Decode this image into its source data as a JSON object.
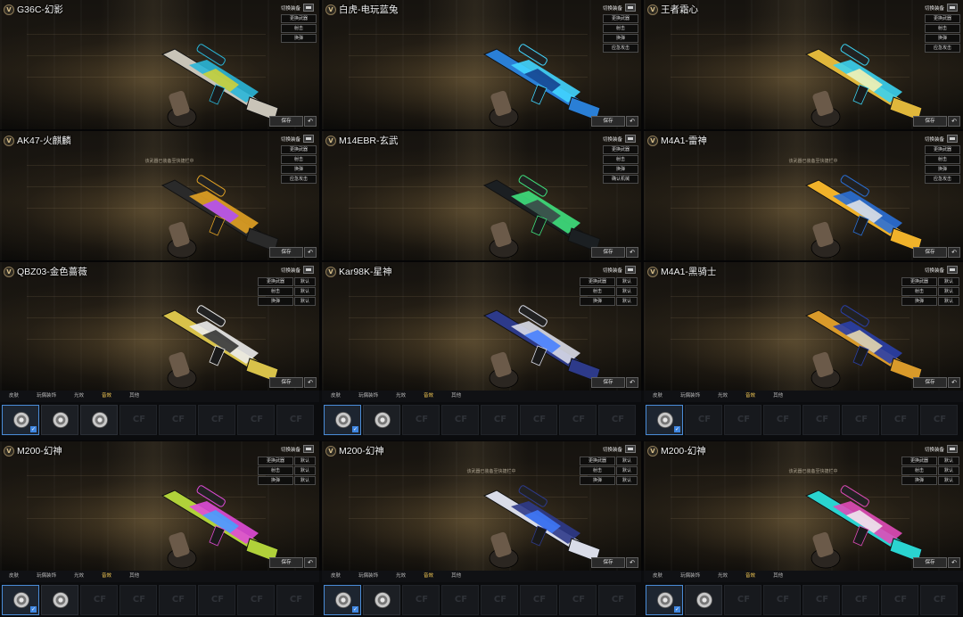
{
  "panels": [
    {
      "name": "G36C-幻影",
      "menu": [
        "更换武器",
        "射击",
        "换弹"
      ],
      "menu_style": "single",
      "hint": "",
      "colors": [
        "#c9c4b8",
        "#2ab6d8",
        "#d7d230"
      ]
    },
    {
      "name": "白虎-电玩蓝兔",
      "menu": [
        "更换武器",
        "射击",
        "换弹",
        "应急攻击"
      ],
      "menu_style": "single",
      "hint": "",
      "colors": [
        "#2a7fd6",
        "#41d5ff",
        "#133a8a"
      ]
    },
    {
      "name": "王者霜心",
      "menu": [
        "更换武器",
        "射击",
        "换弹",
        "应急攻击"
      ],
      "menu_style": "single",
      "hint": "",
      "colors": [
        "#e0b73b",
        "#3bd2f0",
        "#fff3b0"
      ]
    },
    {
      "name": "AK47-火麒麟",
      "menu": [
        "更换武器",
        "射击",
        "换弹",
        "应急攻击"
      ],
      "menu_style": "single",
      "hint": "该武器已装备至快捷栏中",
      "colors": [
        "#2a2a2a",
        "#e2a224",
        "#b24bff"
      ]
    },
    {
      "name": "M14EBR-玄武",
      "menu": [
        "更换武器",
        "射击",
        "换弹",
        "确认机械"
      ],
      "menu_style": "single",
      "hint": "",
      "colors": [
        "#1b1f22",
        "#3fe07d",
        "#3b3f45"
      ]
    },
    {
      "name": "M4A1-雷神",
      "menu": [
        "更换武器",
        "射击",
        "换弹",
        "应急攻击"
      ],
      "menu_style": "single",
      "hint": "该武器已装备至快捷栏中",
      "colors": [
        "#f0b22a",
        "#2a6fd6",
        "#e8e8e8"
      ]
    },
    {
      "name": "QBZ03-金色蔷薇",
      "menu": [
        [
          "更换武器",
          "默认"
        ],
        [
          "射击",
          "默认"
        ],
        [
          "换弹",
          "默认"
        ]
      ],
      "menu_style": "double",
      "hint": "",
      "colors": [
        "#d8c24a",
        "#ececec",
        "#2c2c2c"
      ]
    },
    {
      "name": "Kar98K-星神",
      "menu": [
        [
          "更换武器",
          "默认"
        ],
        [
          "射击",
          "默认"
        ],
        [
          "换弹",
          "默认"
        ]
      ],
      "menu_style": "double",
      "hint": "",
      "colors": [
        "#2d3a8a",
        "#d9dce8",
        "#3f7bff"
      ]
    },
    {
      "name": "M4A1-黑骑士",
      "menu": [
        [
          "更换武器",
          "默认"
        ],
        [
          "射击",
          "默认"
        ],
        [
          "换弹",
          "默认"
        ]
      ],
      "menu_style": "double",
      "hint": "",
      "colors": [
        "#d99a2a",
        "#2a3fa8",
        "#f0e0b0"
      ]
    },
    {
      "name": "M200-幻神",
      "menu": [
        [
          "更换武器",
          "默认"
        ],
        [
          "射击",
          "默认"
        ],
        [
          "换弹",
          "默认"
        ]
      ],
      "menu_style": "double",
      "hint": "",
      "colors": [
        "#b0d13a",
        "#e04bd8",
        "#3fa6ff"
      ]
    },
    {
      "name": "M200-幻神",
      "menu": [
        [
          "更换武器",
          "默认"
        ],
        [
          "射击",
          "默认"
        ],
        [
          "换弹",
          "默认"
        ]
      ],
      "menu_style": "double",
      "hint": "该武器已装备至快捷栏中",
      "colors": [
        "#d9dce8",
        "#2d3a8a",
        "#3f7bff"
      ]
    },
    {
      "name": "M200-幻神",
      "menu": [
        [
          "更换武器",
          "默认"
        ],
        [
          "射击",
          "默认"
        ],
        [
          "换弹",
          "默认"
        ]
      ],
      "menu_style": "double",
      "hint": "该武器已装备至快捷栏中",
      "colors": [
        "#2ad4d0",
        "#e04bb8",
        "#f0f0f0"
      ]
    }
  ],
  "common": {
    "switch_label": "切换装备",
    "save": "保存",
    "back_icon": "return-arrow-icon"
  },
  "strips": [
    {
      "tabs": [
        "皮肤",
        "玩偶装饰",
        "光效",
        "音效",
        "其他"
      ],
      "active": 3,
      "slots": [
        [
          "selected",
          "filled",
          "filled",
          "empty",
          "empty",
          "empty",
          "empty",
          "empty"
        ],
        [
          "selected",
          "filled",
          "empty",
          "empty",
          "empty",
          "empty",
          "empty",
          "empty"
        ],
        [
          "selected",
          "empty",
          "empty",
          "empty",
          "empty",
          "empty",
          "empty",
          "empty"
        ]
      ]
    },
    {
      "tabs": [
        "皮肤",
        "玩偶装饰",
        "光效",
        "音效",
        "其他"
      ],
      "active": 3,
      "slots": [
        [
          "selected",
          "filled",
          "empty",
          "empty",
          "empty",
          "empty",
          "empty",
          "empty"
        ],
        [
          "selected",
          "filled",
          "empty",
          "empty",
          "empty",
          "empty",
          "empty",
          "empty"
        ],
        [
          "selected",
          "filled",
          "empty",
          "empty",
          "empty",
          "empty",
          "empty",
          "empty"
        ]
      ]
    }
  ]
}
